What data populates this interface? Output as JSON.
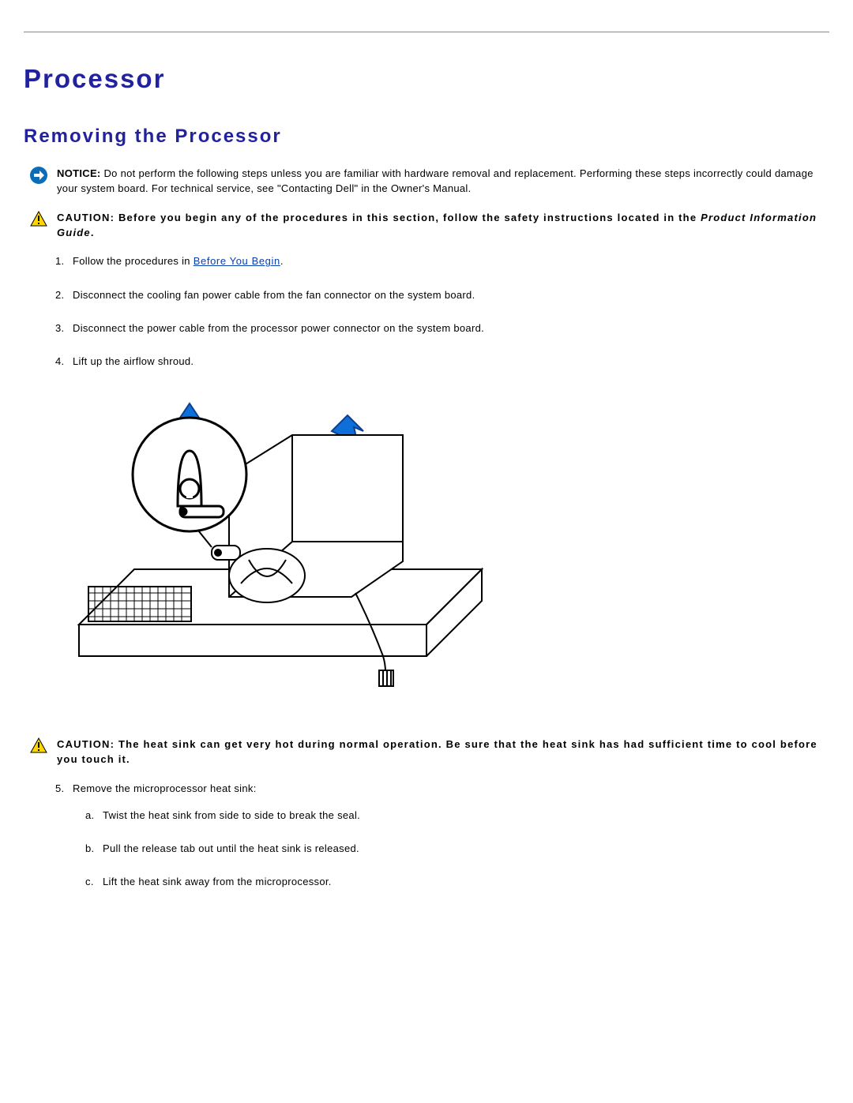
{
  "section": {
    "title": "Processor",
    "subtitle": "Removing the Processor"
  },
  "notice": {
    "label": "NOTICE:",
    "text": " Do not perform the following steps unless you are familiar with hardware removal and replacement. Performing these steps incorrectly could damage your system board. For technical service, see \"Contacting Dell\" in the Owner's Manual."
  },
  "caution1": {
    "label": "CAUTION: ",
    "text": "Before you begin any of the procedures in this section, follow the safety instructions located in the ",
    "ref": "Product Information Guide",
    "period": "."
  },
  "steps": {
    "s1_prefix": "Follow the procedures in ",
    "s1_link": "Before You Begin",
    "s1_suffix": ".",
    "s2": "Disconnect the cooling fan power cable from the fan connector on the system board.",
    "s3": "Disconnect the power cable from the processor power connector on the system board.",
    "s4": "Lift up the airflow shroud.",
    "s5": "Remove the microprocessor heat sink:",
    "s5a": "Twist the heat sink from side to side to break the seal.",
    "s5b": "Pull the release tab out until the heat sink is released.",
    "s5c": "Lift the heat sink away from the microprocessor."
  },
  "caution2": {
    "label": "CAUTION: ",
    "text": "The heat sink can get very hot during normal operation. Be sure that the heat sink has had sufficient time to cool before you touch it."
  }
}
